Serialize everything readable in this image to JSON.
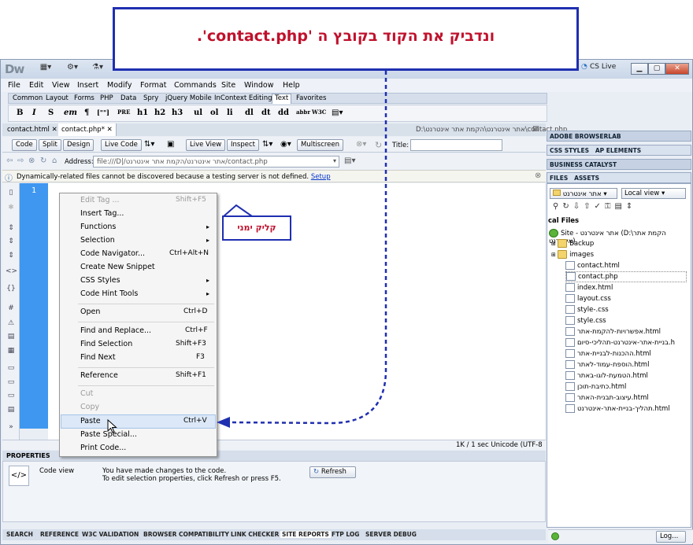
{
  "annotations": {
    "top_callout": "ונדביק את הקוד בקובץ ה 'contact.php'.",
    "right_click_label": "קליק ימני"
  },
  "app": {
    "logo": "Dw",
    "cs_live": "CS Live"
  },
  "menubar": [
    "File",
    "Edit",
    "View",
    "Insert",
    "Modify",
    "Format",
    "Commands",
    "Site",
    "Window",
    "Help"
  ],
  "insert_tabs": [
    "Common",
    "Layout",
    "Forms",
    "PHP",
    "Data",
    "Spry",
    "jQuery Mobile",
    "InContext Editing",
    "Text",
    "Favorites"
  ],
  "insert_active_tab": "Text",
  "text_tools": [
    "B",
    "I",
    "S",
    "em",
    "¶",
    "[\"\"]",
    "PRE",
    "h1",
    "h2",
    "h3",
    "ul",
    "ol",
    "li",
    "dl",
    "dt",
    "dd",
    "abbr",
    "W3C"
  ],
  "doc_tabs": [
    {
      "label": "contact.html",
      "close": "✕"
    },
    {
      "label": "contact.php*",
      "close": "✕"
    }
  ],
  "doc_path": "D:\\אתר אינטרנט\\הקמת אתר אינטרנט\\contact.php",
  "doc_toolbar": {
    "code": "Code",
    "split": "Split",
    "design": "Design",
    "live_code": "Live Code",
    "live_view": "Live View",
    "inspect": "Inspect",
    "multiscreen": "Multiscreen",
    "title_label": "Title:"
  },
  "address": {
    "label": "Address:",
    "value": "file:///D|/אתר אינטרנט/הקמת אתר אינטרנט/contact.php"
  },
  "info_bar": {
    "message": "Dynamically-related files cannot be discovered because a testing server is not defined.",
    "link": "Setup"
  },
  "editor": {
    "line_number": "1"
  },
  "context_menu": [
    {
      "label": "Edit Tag ...",
      "shortcut": "Shift+F5",
      "disabled": true
    },
    {
      "label": "Insert Tag...",
      "shortcut": ""
    },
    {
      "label": "Functions",
      "shortcut": "▸"
    },
    {
      "label": "Selection",
      "shortcut": "▸"
    },
    {
      "label": "Code Navigator...",
      "shortcut": "Ctrl+Alt+N"
    },
    {
      "label": "Create New Snippet",
      "shortcut": ""
    },
    {
      "label": "CSS Styles",
      "shortcut": "▸"
    },
    {
      "label": "Code Hint Tools",
      "shortcut": "▸"
    },
    {
      "label": "Open",
      "shortcut": "Ctrl+D"
    },
    {
      "label": "Find and Replace...",
      "shortcut": "Ctrl+F"
    },
    {
      "label": "Find Selection",
      "shortcut": "Shift+F3"
    },
    {
      "label": "Find Next",
      "shortcut": "F3"
    },
    {
      "label": "Reference",
      "shortcut": "Shift+F1"
    },
    {
      "label": "Cut",
      "shortcut": "",
      "disabled": true
    },
    {
      "label": "Copy",
      "shortcut": "",
      "disabled": true
    },
    {
      "label": "Paste",
      "shortcut": "Ctrl+V"
    },
    {
      "label": "Paste Special...",
      "shortcut": ""
    },
    {
      "label": "Print Code...",
      "shortcut": ""
    }
  ],
  "status": {
    "right": "1K / 1 sec  Unicode (UTF-8"
  },
  "properties": {
    "header": "PROPERTIES",
    "code_view": "Code view",
    "line1": "You have made changes to the code.",
    "line2": "To edit selection properties, click Refresh or press F5.",
    "refresh": "Refresh"
  },
  "bottom_tabs": [
    "SEARCH",
    "REFERENCE",
    "W3C VALIDATION",
    "BROWSER COMPATIBILITY",
    "LINK CHECKER",
    "SITE REPORTS",
    "FTP LOG",
    "SERVER DEBUG"
  ],
  "right_panels": {
    "browserlab": "ADOBE BROWSERLAB",
    "css_styles": "CSS STYLES",
    "ap_elements": "AP ELEMENTS",
    "business_catalyst": "BUSINESS CATALYST",
    "files": "FILES",
    "assets": "ASSETS",
    "site_select": "אתר אינטרנט",
    "view_select": "Local view",
    "local_files": "cal Files",
    "site_root": "Site - אתר אינטרנט (D:\\הקמת אתר אינטרנט)",
    "log_button": "Log..."
  },
  "files": [
    {
      "name": "Backup",
      "type": "folder"
    },
    {
      "name": "images",
      "type": "folder"
    },
    {
      "name": "contact.html",
      "type": "file"
    },
    {
      "name": "contact.php",
      "type": "file"
    },
    {
      "name": "index.html",
      "type": "file"
    },
    {
      "name": "layout.css",
      "type": "file"
    },
    {
      "name": "style-.css",
      "type": "file"
    },
    {
      "name": "style.css",
      "type": "file"
    },
    {
      "name": "אפשרויות-להקמת-אתר.html",
      "type": "file"
    },
    {
      "name": "בניית-אתר-אינטרנט-תהליכי-סיום.h",
      "type": "file"
    },
    {
      "name": "ההכנות-לבניית-אתר.html",
      "type": "file"
    },
    {
      "name": "הוספת-עמוד-לאתר.html",
      "type": "file"
    },
    {
      "name": "הטמעת-לוגו-באתר.html",
      "type": "file"
    },
    {
      "name": "כתיבת-תוכן.html",
      "type": "file"
    },
    {
      "name": "עיצוב-תבנית-האתר.html",
      "type": "file"
    },
    {
      "name": "תהליך-בניית-אתר-אינטרנט.html",
      "type": "file"
    }
  ],
  "colors": {
    "annotation_blue": "#1f2fb0",
    "annotation_red": "#c0112c",
    "gutter": "#3f97f0"
  }
}
